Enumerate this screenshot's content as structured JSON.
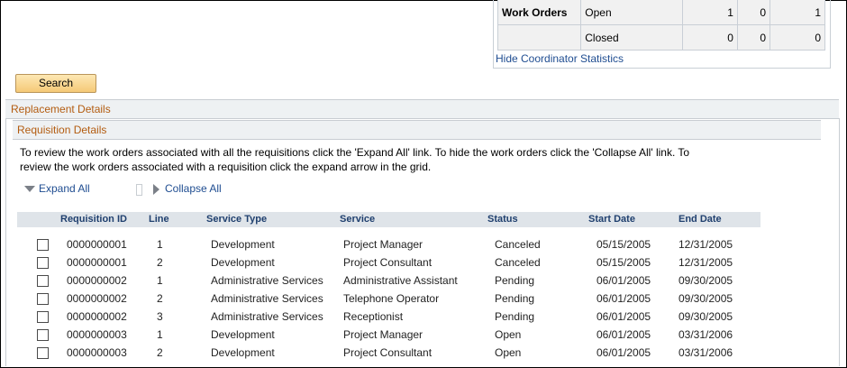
{
  "coordinator_stats": {
    "rows": [
      {
        "group": "Work Orders",
        "label": "Open",
        "v1": "1",
        "v2": "0",
        "v3": "1"
      },
      {
        "group": "",
        "label": "Closed",
        "v1": "0",
        "v2": "0",
        "v3": "0"
      }
    ],
    "hide_link": "Hide Coordinator Statistics"
  },
  "search_label": "Search",
  "replacement_details": "Replacement Details",
  "requisition_details": "Requisition Details",
  "instructions": "To review the work orders associated with all the requisitions click the 'Expand All' link. To hide the work orders click the 'Collapse All' link. To review the work orders associated with a requisition click the expand arrow in the grid.",
  "expand_all": "Expand All",
  "collapse_all": "Collapse All",
  "grid": {
    "columns": [
      "Requisition ID",
      "Line",
      "Service Type",
      "Service",
      "Status",
      "Start Date",
      "End Date"
    ],
    "rows": [
      [
        "0000000001",
        "1",
        "Development",
        "Project Manager",
        "Canceled",
        "05/15/2005",
        "12/31/2005"
      ],
      [
        "0000000001",
        "2",
        "Development",
        "Project Consultant",
        "Canceled",
        "05/15/2005",
        "12/31/2005"
      ],
      [
        "0000000002",
        "1",
        "Administrative Services",
        "Administrative Assistant",
        "Pending",
        "06/01/2005",
        "09/30/2005"
      ],
      [
        "0000000002",
        "2",
        "Administrative Services",
        "Telephone Operator",
        "Pending",
        "06/01/2005",
        "09/30/2005"
      ],
      [
        "0000000002",
        "3",
        "Administrative Services",
        "Receptionist",
        "Pending",
        "06/01/2005",
        "09/30/2005"
      ],
      [
        "0000000003",
        "1",
        "Development",
        "Project Manager",
        "Open",
        "06/01/2005",
        "03/31/2006"
      ],
      [
        "0000000003",
        "2",
        "Development",
        "Project Consultant",
        "Open",
        "06/01/2005",
        "03/31/2006"
      ]
    ]
  }
}
